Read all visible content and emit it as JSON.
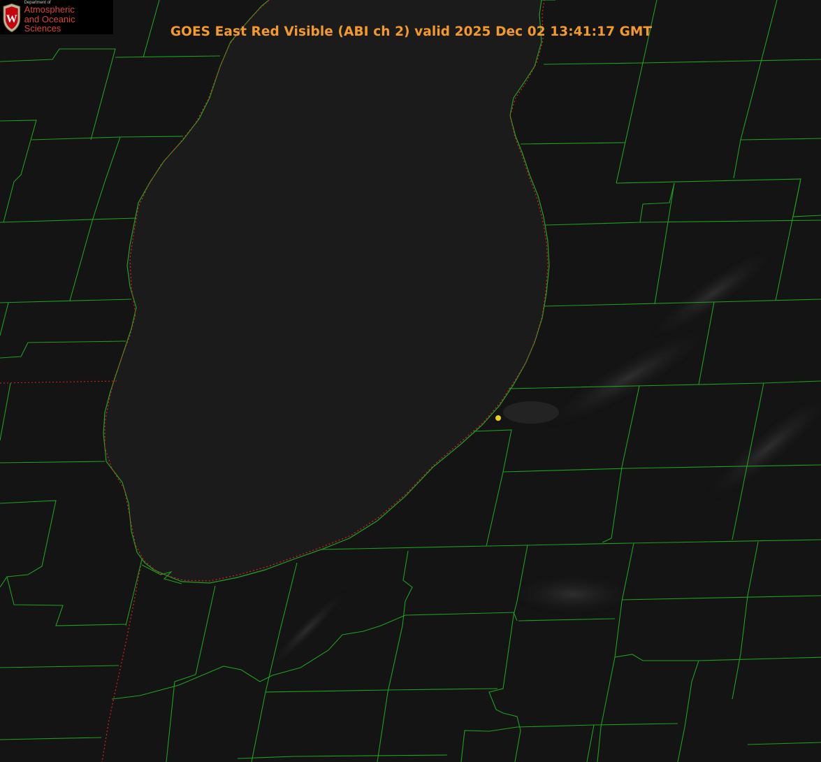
{
  "title": "GOES East Red Visible (ABI ch 2) valid 2025 Dec 02 13:41:17 GMT",
  "logo": {
    "line0": "Department of",
    "line1": "Atmospheric",
    "line2": "and Oceanic Sciences",
    "crest_letter": "W"
  },
  "colors": {
    "background": "#121212",
    "lake": "#1d1d1d",
    "county_lines": "#1fa01f",
    "state_border": "#e02020",
    "title": "#f39a2b",
    "marker": "#e6d21f"
  },
  "icons": [
    "uw-crest-icon",
    "location-marker-icon"
  ]
}
